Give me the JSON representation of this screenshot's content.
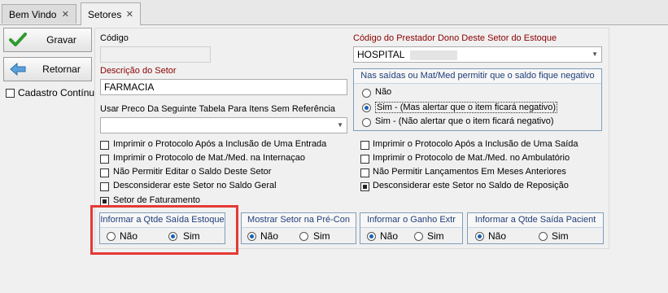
{
  "tabs": [
    {
      "label": "Bem Vindo",
      "close": "✕"
    },
    {
      "label": "Setores",
      "close": "✕"
    }
  ],
  "actions": {
    "gravar": "Gravar",
    "retornar": "Retornar",
    "cadastro_continuo": "Cadastro Contínuo"
  },
  "form": {
    "codigo_label": "Código",
    "codigo_value": "",
    "descricao_label": "Descrição do Setor",
    "descricao_value": "FARMACIA",
    "tabela_label": "Usar Preco Da Seguinte Tabela Para Itens Sem Referência",
    "tabela_value": "",
    "prestador_label": "Código do Prestador Dono Deste Setor do Estoque",
    "prestador_value": "HOSPITAL"
  },
  "saldo_group": {
    "title": "Nas saídas ou Mat/Med permitir que o saldo fique negativo",
    "options": [
      "Não",
      "Sim - (Mas alertar que o item ficará negativo)",
      "Sim - (Não alertar que o item ficará negativo)"
    ],
    "selected": 1
  },
  "checks_left": [
    {
      "label": "Imprimir o Protocolo Após a Inclusão de Uma Entrada",
      "checked": false
    },
    {
      "label": "Imprimir o Protocolo de Mat./Med. na Internaçao",
      "checked": false
    },
    {
      "label": "Não Permitir Editar o Saldo Deste Setor",
      "checked": false
    },
    {
      "label": "Desconsiderar este Setor no Saldo Geral",
      "checked": false
    },
    {
      "label": "Setor de Faturamento",
      "checked": true
    }
  ],
  "checks_right": [
    {
      "label": "Imprimir o Protocolo Após a Inclusão de Uma Saída",
      "checked": false
    },
    {
      "label": "Imprimir o Protocolo de Mat./Med. no Ambulatório",
      "checked": false
    },
    {
      "label": "Não Permitir Lançamentos Em Meses Anteriores",
      "checked": false
    },
    {
      "label": "Desconsiderar este Setor no Saldo de Reposição",
      "checked": true
    }
  ],
  "bottom_groups": [
    {
      "title": "Informar a Qtde Saída Estoque",
      "no": "Não",
      "yes": "Sim",
      "selected": "yes"
    },
    {
      "title": "Mostrar Setor na Pré-Con",
      "no": "Não",
      "yes": "Sim",
      "selected": "no"
    },
    {
      "title": "Informar o Ganho Extr",
      "no": "Não",
      "yes": "Sim",
      "selected": "no"
    },
    {
      "title": "Informar a Qtde Saída Pacient",
      "no": "Não",
      "yes": "Sim",
      "selected": "no"
    }
  ],
  "colors": {
    "accent_red": "#e53935",
    "label_red": "#8b0000",
    "group_title": "#1f3d7a"
  }
}
